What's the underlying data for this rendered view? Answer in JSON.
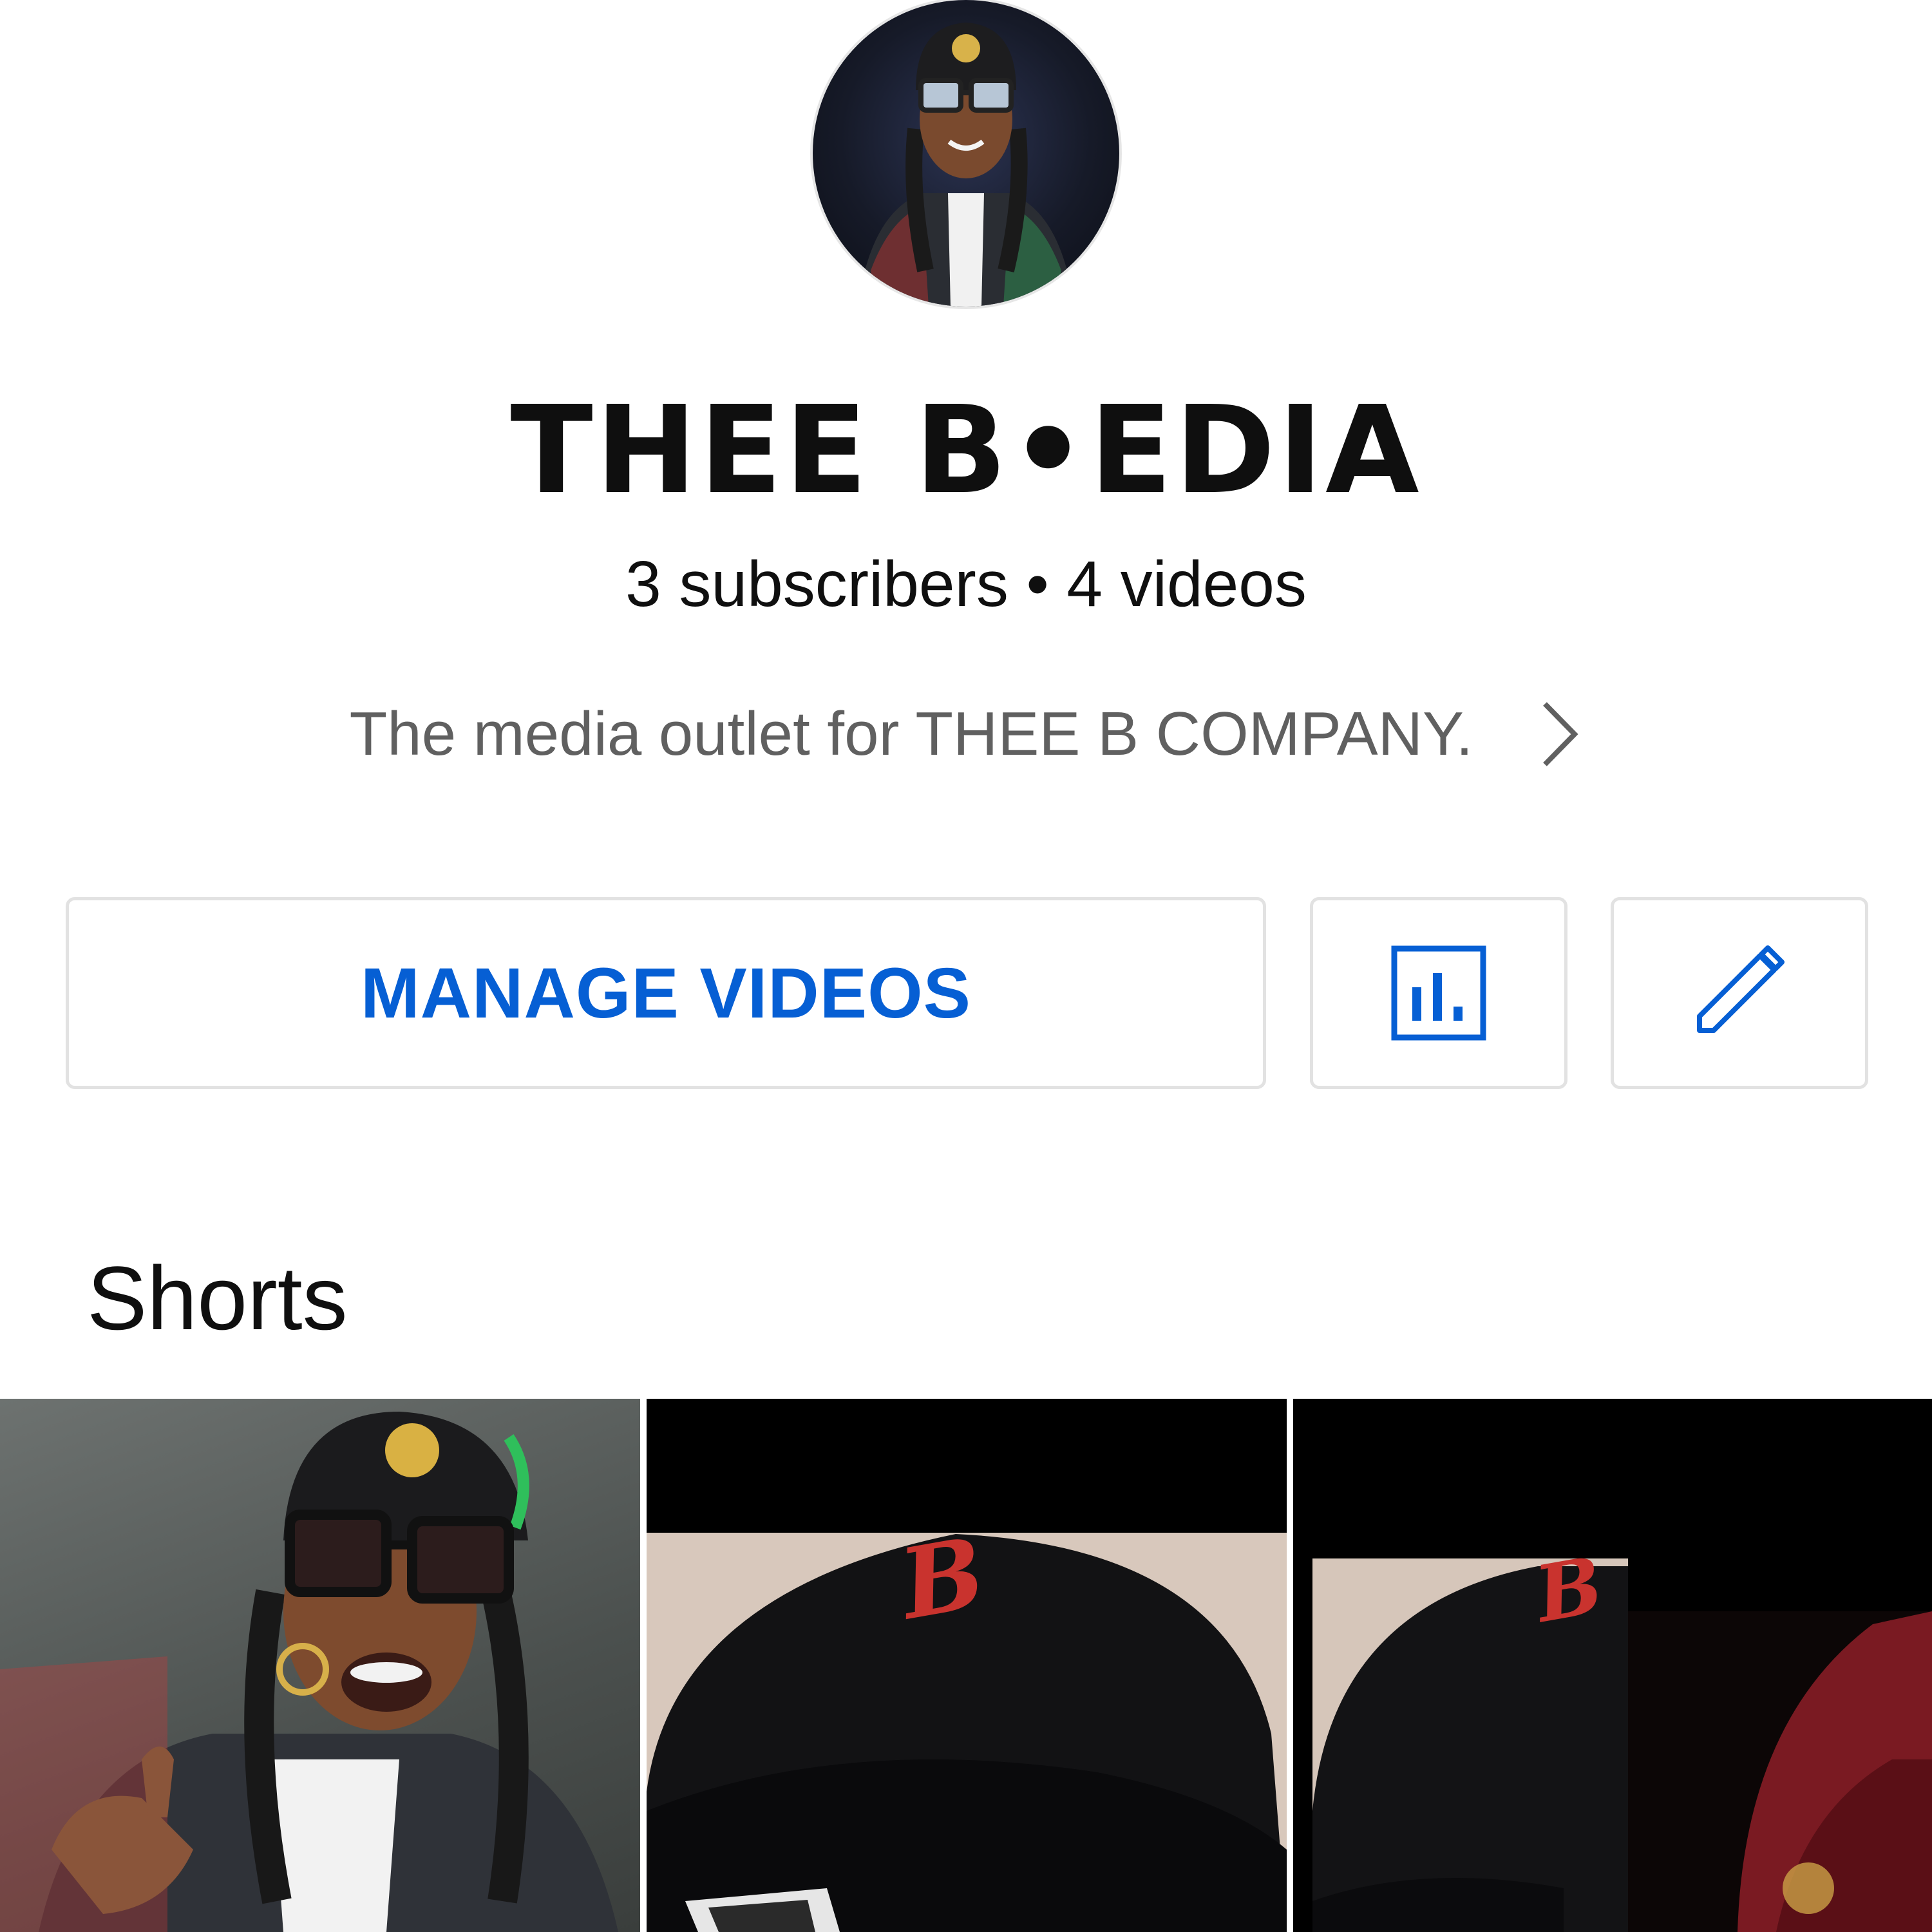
{
  "channel": {
    "name": "THEE B•EDIA",
    "stats": "3 subscribers • 4 videos",
    "description": "The media outlet for THEE B COMPANY."
  },
  "actions": {
    "manage_videos_label": "MANAGE VIDEOS",
    "analytics_icon": "analytics-icon",
    "edit_icon": "pencil-icon"
  },
  "shorts": {
    "title": "Shorts",
    "items": [
      {
        "thumbnail": "short-thumbnail-1"
      },
      {
        "thumbnail": "short-thumbnail-2"
      },
      {
        "thumbnail": "short-thumbnail-3"
      }
    ]
  },
  "colors": {
    "accent": "#065fd4",
    "text_primary": "#0f0f0f",
    "text_secondary": "#606060",
    "border": "#e2e2e2"
  }
}
